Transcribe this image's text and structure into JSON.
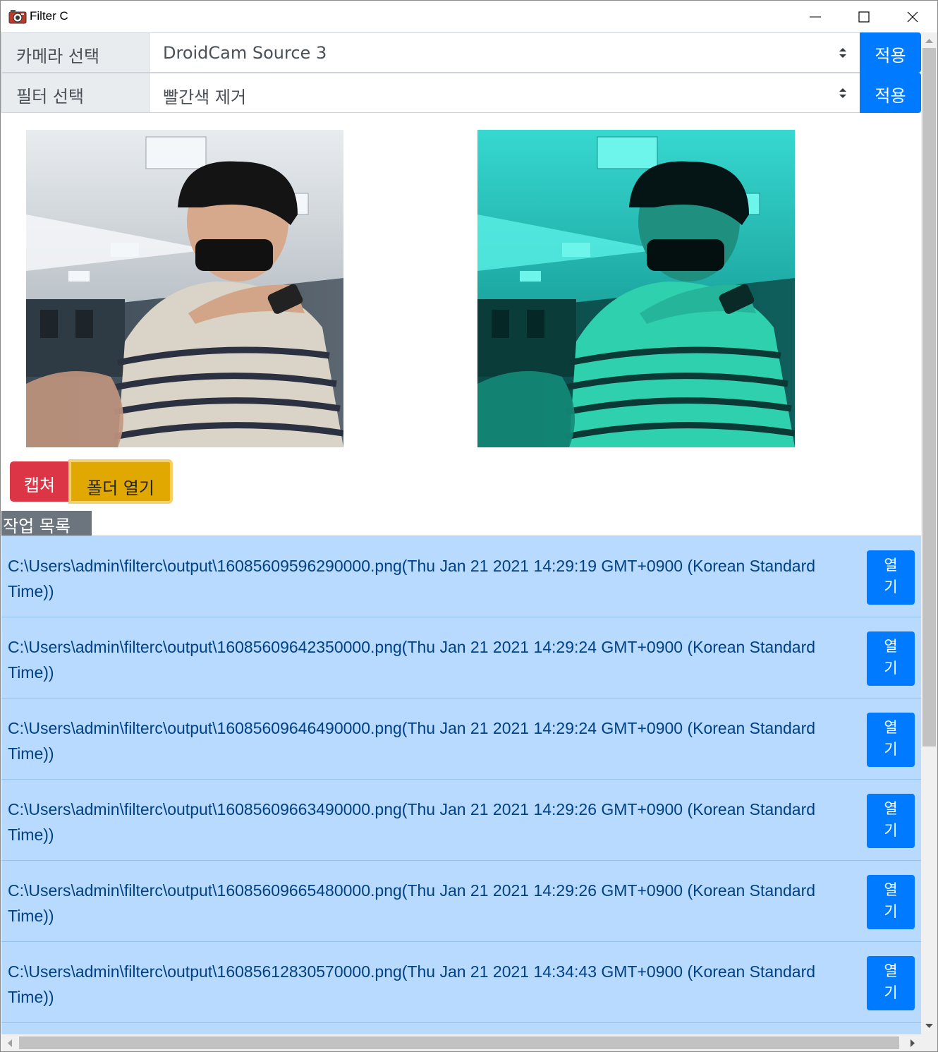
{
  "window": {
    "title": "Filter C"
  },
  "camera_row": {
    "label": "카메라 선택",
    "selected": "DroidCam Source 3",
    "apply_label": "적용"
  },
  "filter_row": {
    "label": "필터 선택",
    "selected": "빨간색 제거",
    "apply_label": "적용"
  },
  "actions": {
    "capture_label": "캡쳐",
    "open_folder_label": "폴더 열기"
  },
  "job_list": {
    "label": "작업 목록",
    "open_label_line1": "열",
    "open_label_line2": "기",
    "items": [
      {
        "text": "C:\\Users\\admin\\filterc\\output\\16085609596290000.png(Thu Jan 21 2021 14:29:19 GMT+0900 (Korean Standard Time))"
      },
      {
        "text": "C:\\Users\\admin\\filterc\\output\\16085609642350000.png(Thu Jan 21 2021 14:29:24 GMT+0900 (Korean Standard Time))"
      },
      {
        "text": "C:\\Users\\admin\\filterc\\output\\16085609646490000.png(Thu Jan 21 2021 14:29:24 GMT+0900 (Korean Standard Time))"
      },
      {
        "text": "C:\\Users\\admin\\filterc\\output\\16085609663490000.png(Thu Jan 21 2021 14:29:26 GMT+0900 (Korean Standard Time))"
      },
      {
        "text": "C:\\Users\\admin\\filterc\\output\\16085609665480000.png(Thu Jan 21 2021 14:29:26 GMT+0900 (Korean Standard Time))"
      },
      {
        "text": "C:\\Users\\admin\\filterc\\output\\16085612830570000.png(Thu Jan 21 2021 14:34:43 GMT+0900 (Korean Standard Time))"
      }
    ]
  },
  "icons": {
    "app": "camera-icon",
    "minimize": "minimize-icon",
    "maximize": "maximize-icon",
    "close": "close-icon",
    "select_arrow": "select-updown-icon"
  },
  "colors": {
    "primary": "#007bff",
    "danger": "#dc3545",
    "warning": "#e0a800",
    "secondary": "#6c757d",
    "list_item_bg": "#b8daff",
    "list_item_text": "#004085"
  }
}
